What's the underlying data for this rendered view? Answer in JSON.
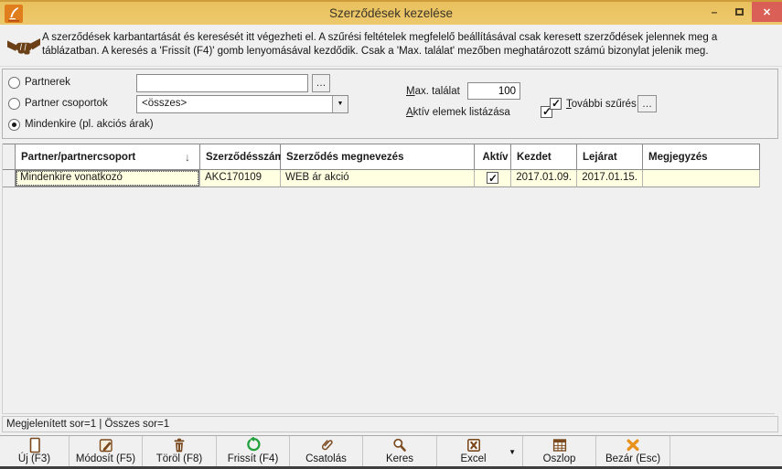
{
  "window": {
    "title": "Szerződések kezelése"
  },
  "icons": {
    "minimize": "–",
    "close": "✕",
    "dropdown_arrow": "▼",
    "sort_desc": "↓",
    "check_mark": "✓",
    "app_icon": "svg-quill",
    "handshake_icon": "svg-handshake",
    "toolbar_icons": "svg (new-document, edit, trash, refresh, paperclip, search, excel, table-columns, close-x)"
  },
  "colors": {
    "titlebar": "#ecc464",
    "close_button": "#d95f57",
    "row_highlight": "#ffffe1",
    "icon_brown": "#7a4a1e",
    "icon_green": "#22a03c",
    "icon_orange": "#e8911c"
  },
  "info": {
    "text": "A szerződések karbantartását és keresését itt végezheti el. A szűrési feltételek megfelelő beállításával csak keresett szerződések jelennek meg a táblázatban. A keresés a 'Frissít (F4)' gomb lenyomásával kezdődik. Csak a 'Max. találat' mezőben meghatározott számú bizonylat jelenik meg."
  },
  "filters": {
    "radios": [
      {
        "label": "Partnerek",
        "selected": false
      },
      {
        "label": "Partner csoportok",
        "selected": false
      },
      {
        "label": "Mindenkire (pl. akciós árak)",
        "selected": true
      }
    ],
    "partner_input": {
      "value": "",
      "browse_label": "…"
    },
    "partner_group_select": {
      "value": "<összes>"
    },
    "max_results": {
      "label_key": "M",
      "label_rest": "ax. találat",
      "value": "100"
    },
    "active_only": {
      "label_key": "A",
      "label_rest": "ktív elemek listázása",
      "checked": true
    },
    "more_filter": {
      "label_key": "T",
      "label_rest": "ovábbi szűrés",
      "checked": true,
      "browse_label": "…"
    }
  },
  "table": {
    "columns": [
      {
        "label": "Partner/partnercsoport",
        "sort": "desc"
      },
      {
        "label": "Szerződésszám"
      },
      {
        "label": "Szerződés megnevezés"
      },
      {
        "label": "Aktív"
      },
      {
        "label": "Kezdet"
      },
      {
        "label": "Lejárat"
      },
      {
        "label": "Megjegyzés"
      }
    ],
    "rows": [
      {
        "partner": "Mindenkire vonatkozó",
        "contract_no": "AKC170109",
        "name": "WEB ár akció",
        "active": true,
        "start": "2017.01.09.",
        "end": "2017.01.15.",
        "note": ""
      }
    ]
  },
  "status": {
    "text": "Megjelenített sor=1 | Összes sor=1"
  },
  "toolbar": {
    "buttons": [
      {
        "label": "Új (F3)"
      },
      {
        "label": "Módosít (F5)"
      },
      {
        "label": "Töröl (F8)"
      },
      {
        "label": "Frissít (F4)"
      },
      {
        "label": "Csatolás"
      },
      {
        "label": "Keres"
      },
      {
        "label": "Excel",
        "has_dropdown": true
      },
      {
        "label": "Oszlop"
      },
      {
        "label": "Bezár (Esc)"
      }
    ]
  }
}
